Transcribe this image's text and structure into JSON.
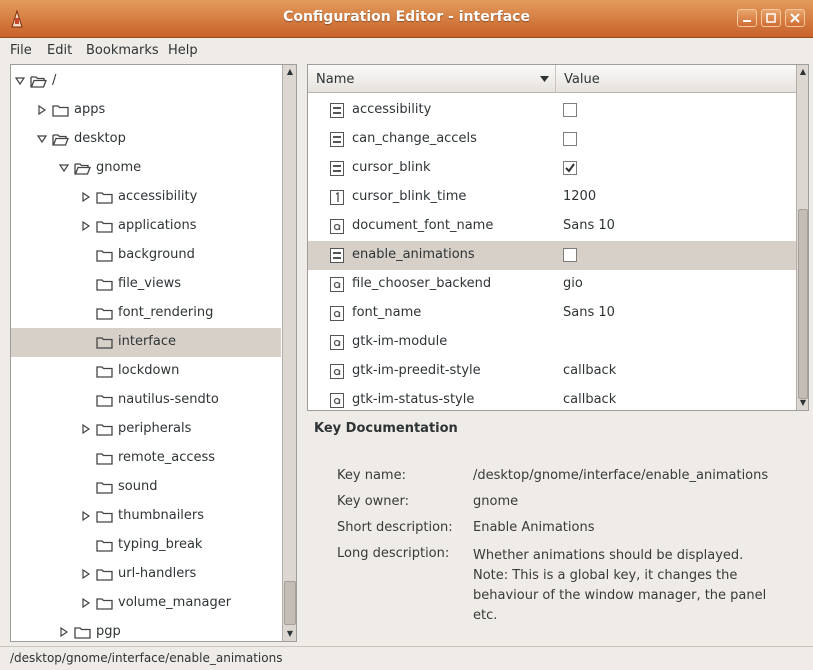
{
  "window": {
    "title": "Configuration Editor - interface"
  },
  "menubar": {
    "items": [
      "File",
      "Edit",
      "Bookmarks",
      "Help"
    ]
  },
  "tree": {
    "items": [
      {
        "label": "/",
        "depth": 0,
        "expander": "open",
        "folder": "open"
      },
      {
        "label": "apps",
        "depth": 1,
        "expander": "closed",
        "folder": "closed"
      },
      {
        "label": "desktop",
        "depth": 1,
        "expander": "open",
        "folder": "open"
      },
      {
        "label": "gnome",
        "depth": 2,
        "expander": "open",
        "folder": "open"
      },
      {
        "label": "accessibility",
        "depth": 3,
        "expander": "closed",
        "folder": "closed"
      },
      {
        "label": "applications",
        "depth": 3,
        "expander": "closed",
        "folder": "closed"
      },
      {
        "label": "background",
        "depth": 3,
        "expander": "none",
        "folder": "closed"
      },
      {
        "label": "file_views",
        "depth": 3,
        "expander": "none",
        "folder": "closed"
      },
      {
        "label": "font_rendering",
        "depth": 3,
        "expander": "none",
        "folder": "closed"
      },
      {
        "label": "interface",
        "depth": 3,
        "expander": "none",
        "folder": "closed",
        "selected": true
      },
      {
        "label": "lockdown",
        "depth": 3,
        "expander": "none",
        "folder": "closed"
      },
      {
        "label": "nautilus-sendto",
        "depth": 3,
        "expander": "none",
        "folder": "closed"
      },
      {
        "label": "peripherals",
        "depth": 3,
        "expander": "closed",
        "folder": "closed"
      },
      {
        "label": "remote_access",
        "depth": 3,
        "expander": "none",
        "folder": "closed"
      },
      {
        "label": "sound",
        "depth": 3,
        "expander": "none",
        "folder": "closed"
      },
      {
        "label": "thumbnailers",
        "depth": 3,
        "expander": "closed",
        "folder": "closed"
      },
      {
        "label": "typing_break",
        "depth": 3,
        "expander": "none",
        "folder": "closed"
      },
      {
        "label": "url-handlers",
        "depth": 3,
        "expander": "closed",
        "folder": "closed"
      },
      {
        "label": "volume_manager",
        "depth": 3,
        "expander": "closed",
        "folder": "closed"
      },
      {
        "label": "pgp",
        "depth": 2,
        "expander": "closed",
        "folder": "closed"
      }
    ]
  },
  "keys": {
    "columns": {
      "name": "Name",
      "value": "Value"
    },
    "rows": [
      {
        "name": "accessibility",
        "type": "bool",
        "checked": false
      },
      {
        "name": "can_change_accels",
        "type": "bool",
        "checked": false
      },
      {
        "name": "cursor_blink",
        "type": "bool",
        "checked": true
      },
      {
        "name": "cursor_blink_time",
        "type": "int",
        "value": "1200"
      },
      {
        "name": "document_font_name",
        "type": "string",
        "value": "Sans 10"
      },
      {
        "name": "enable_animations",
        "type": "bool",
        "checked": false,
        "selected": true
      },
      {
        "name": "file_chooser_backend",
        "type": "string",
        "value": "gio"
      },
      {
        "name": "font_name",
        "type": "string",
        "value": "Sans 10"
      },
      {
        "name": "gtk-im-module",
        "type": "string",
        "value": ""
      },
      {
        "name": "gtk-im-preedit-style",
        "type": "string",
        "value": "callback"
      },
      {
        "name": "gtk-im-status-style",
        "type": "string",
        "value": "callback"
      }
    ]
  },
  "documentation": {
    "title": "Key Documentation",
    "key_name_label": "Key name:",
    "key_name": "/desktop/gnome/interface/enable_animations",
    "key_owner_label": "Key owner:",
    "key_owner": "gnome",
    "short_desc_label": "Short description:",
    "short_desc": "Enable Animations",
    "long_desc_label": "Long description:",
    "long_desc_lines": [
      "Whether animations should be displayed.",
      "Note: This is a global key, it changes the",
      "behaviour of the window manager, the panel",
      "etc."
    ]
  },
  "statusbar": {
    "text": "/desktop/gnome/interface/enable_animations"
  },
  "colors": {
    "titlebar": "#d67a3f",
    "selection": "#d6d0c9"
  }
}
